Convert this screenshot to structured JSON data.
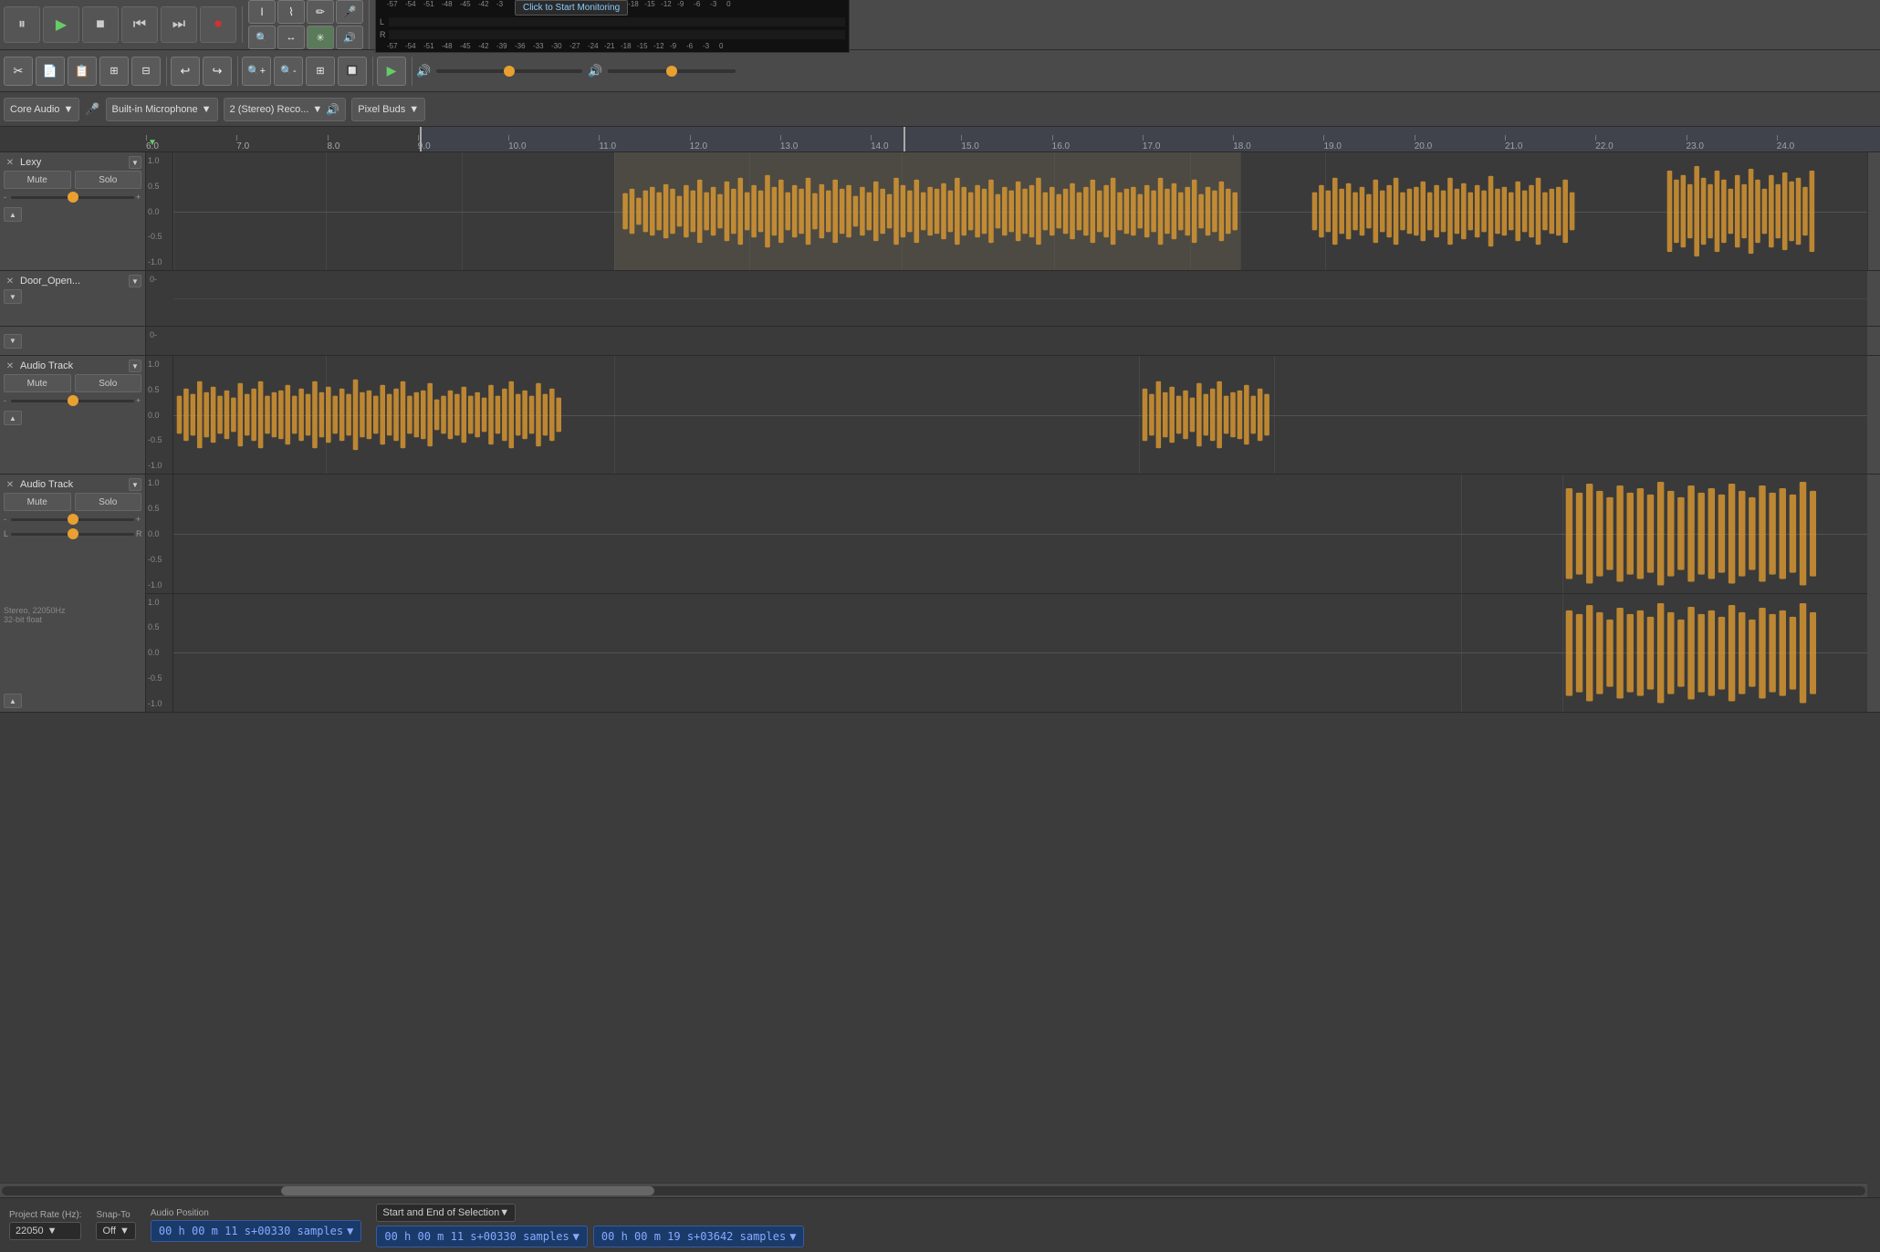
{
  "app": {
    "title": "Audacity"
  },
  "toolbar": {
    "pause_label": "⏸",
    "play_label": "▶",
    "stop_label": "■",
    "skip_back_label": "⏮",
    "skip_fwd_label": "⏭",
    "record_label": "⏺",
    "tool_select": "I",
    "tool_envelope": "~",
    "tool_draw": "✏",
    "tool_mic": "🎤",
    "tool_zoom": "🔍",
    "tool_resize": "↔",
    "tool_multi": "✳",
    "tool_speaker": "🔊",
    "edit_cut": "✂",
    "edit_copy": "□",
    "edit_paste": "📋",
    "edit_trim": "|||",
    "edit_silence": "|||",
    "undo": "↩",
    "redo": "↪",
    "zoom_in": "🔍",
    "zoom_out": "🔍",
    "fit_project": "🔍",
    "zoom_sel": "🔍",
    "play_at": "▶",
    "volume_slider_pos": "50%",
    "gain_slider_pos": "50%"
  },
  "devices": {
    "host": "Core Audio",
    "input": "Built-in Microphone",
    "channels": "2 (Stereo) Reco...",
    "output": "Pixel Buds"
  },
  "vu_meter": {
    "click_to_start": "Click to Start Monitoring",
    "scale": [
      "-57",
      "-54",
      "-51",
      "-48",
      "-45",
      "-42",
      "-39",
      "-3 |",
      "",
      "",
      "",
      "",
      "-21",
      "-18",
      "-15",
      "-12",
      "-9",
      "-6",
      "-3",
      "0"
    ],
    "scale2": [
      "-57",
      "-54",
      "-51",
      "-48",
      "-45",
      "-42",
      "-39",
      "-36",
      "-33",
      "-30",
      "-27",
      "-24",
      "-21",
      "-18",
      "-15",
      "-12",
      "-9",
      "-6",
      "-3",
      "0"
    ]
  },
  "ruler": {
    "marks": [
      "6.0",
      "7.0",
      "8.0",
      "9.0",
      "10.0",
      "11.0",
      "12.0",
      "13.0",
      "14.0",
      "15.0",
      "16.0",
      "17.0",
      "18.0",
      "19.0",
      "20.0",
      "21.0",
      "22.0",
      "23.0",
      "24.0"
    ]
  },
  "tracks": [
    {
      "id": "lexy",
      "name": "Lexy",
      "type": "stereo",
      "mute": false,
      "solo": false,
      "volume_pos": "50%",
      "pan_pos": "50%",
      "scale_max": "1.0",
      "scale_mid1": "0.5",
      "scale_zero": "0.0",
      "scale_mid2": "-0.5",
      "scale_min": "-1.0",
      "has_waveform": true,
      "waveform_start_pct": 26,
      "waveform_end_pct": 63,
      "waveform_start2_pct": 67,
      "waveform_end2_pct": 83,
      "waveform_start3_pct": 88,
      "waveform_end3_pct": 97
    },
    {
      "id": "door_open",
      "name": "Door_Open...",
      "type": "label",
      "collapsed": true
    },
    {
      "id": "audio_track_1",
      "name": "Audio Track",
      "type": "mono",
      "mute": false,
      "solo": false,
      "volume_pos": "50%",
      "pan_pos": "50%",
      "scale_max": "1.0",
      "scale_mid1": "0.5",
      "scale_zero": "0.0",
      "scale_mid2": "-0.5",
      "scale_min": "-1.0",
      "has_waveform": true
    },
    {
      "id": "audio_track_2",
      "name": "Audio Track",
      "type": "stereo",
      "mute": false,
      "solo": false,
      "volume_pos": "50%",
      "pan_pos": "50%",
      "pan_label_l": "L",
      "pan_label_r": "R",
      "scale_max": "1.0",
      "scale_mid1": "0.5",
      "scale_zero": "0.0",
      "scale_mid2": "-0.5",
      "scale_min": "-1.0",
      "info": "Stereo, 22050Hz\n32-bit float",
      "has_waveform": true
    }
  ],
  "bottom_bar": {
    "project_rate_label": "Project Rate (Hz):",
    "project_rate": "22050",
    "snap_to_label": "Snap-To",
    "snap_to_value": "Off",
    "audio_pos_label": "Audio Position",
    "audio_pos_value": "00 h 00 m 11 s+00330 samples",
    "selection_label": "Start and End of Selection",
    "sel_start": "00 h 00 m 11 s+00330 samples",
    "sel_end": "00 h 00 m 19 s+03642 samples"
  }
}
